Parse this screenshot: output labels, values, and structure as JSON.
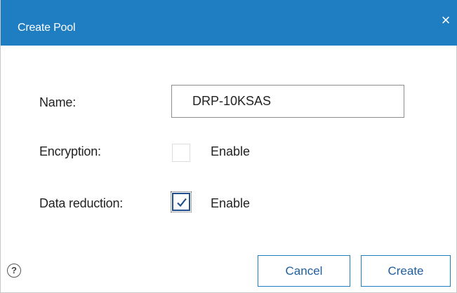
{
  "dialog": {
    "title": "Create Pool",
    "close_glyph": "×"
  },
  "form": {
    "name_label": "Name:",
    "name_value": "DRP-10KSAS",
    "encryption_label": "Encryption:",
    "encryption_option": "Enable",
    "encryption_checked": false,
    "data_reduction_label": "Data reduction:",
    "data_reduction_option": "Enable",
    "data_reduction_checked": true
  },
  "footer": {
    "help_glyph": "?",
    "cancel_label": "Cancel",
    "create_label": "Create"
  },
  "colors": {
    "accent": "#1f7dc1",
    "button_text": "#1f5e9e"
  }
}
